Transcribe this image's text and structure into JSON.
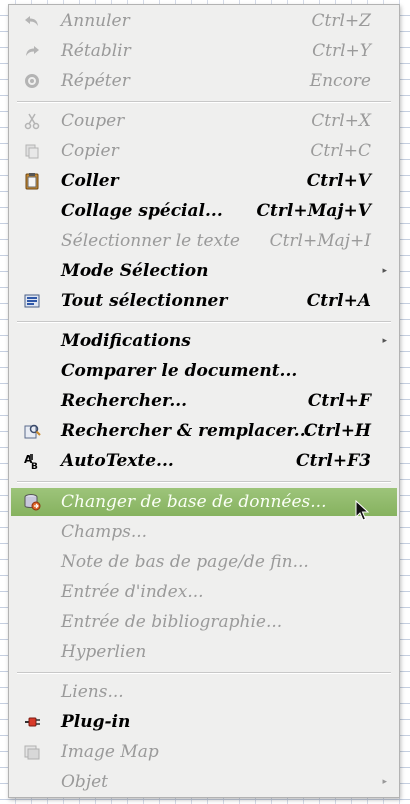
{
  "menu": {
    "items": [
      {
        "label": "Annuler",
        "shortcut": "Ctrl+Z",
        "icon": "undo-icon",
        "disabled": true
      },
      {
        "label": "Rétablir",
        "shortcut": "Ctrl+Y",
        "icon": "redo-icon",
        "disabled": true
      },
      {
        "label": "Répéter",
        "shortcut": "Encore",
        "icon": "repeat-icon",
        "disabled": true
      },
      {
        "label": "Couper",
        "shortcut": "Ctrl+X",
        "icon": "scissors-icon",
        "disabled": true
      },
      {
        "label": "Copier",
        "shortcut": "Ctrl+C",
        "icon": "copy-icon",
        "disabled": true
      },
      {
        "label": "Coller",
        "shortcut": "Ctrl+V",
        "icon": "paste-icon",
        "disabled": false
      },
      {
        "label": "Collage spécial...",
        "shortcut": "Ctrl+Maj+V",
        "icon": "",
        "disabled": false
      },
      {
        "label": "Sélectionner le texte",
        "shortcut": "Ctrl+Maj+I",
        "icon": "",
        "disabled": true
      },
      {
        "label": "Mode Sélection",
        "shortcut": "",
        "icon": "",
        "disabled": false,
        "submenu": true
      },
      {
        "label": "Tout sélectionner",
        "shortcut": "Ctrl+A",
        "icon": "select-all-icon",
        "disabled": false
      },
      {
        "label": "Modifications",
        "shortcut": "",
        "icon": "",
        "disabled": false,
        "submenu": true
      },
      {
        "label": "Comparer le document...",
        "shortcut": "",
        "icon": "",
        "disabled": false
      },
      {
        "label": "Rechercher...",
        "shortcut": "Ctrl+F",
        "icon": "",
        "disabled": false
      },
      {
        "label": "Rechercher & remplacer...",
        "shortcut": "Ctrl+H",
        "icon": "find-replace-icon",
        "disabled": false
      },
      {
        "label": "AutoTexte...",
        "shortcut": "Ctrl+F3",
        "icon": "autotext-icon",
        "disabled": false
      },
      {
        "label": "Changer de base de données...",
        "shortcut": "",
        "icon": "database-icon",
        "disabled": false,
        "selected": true
      },
      {
        "label": "Champs...",
        "shortcut": "",
        "icon": "",
        "disabled": true
      },
      {
        "label": "Note de bas de page/de fin...",
        "shortcut": "",
        "icon": "",
        "disabled": true
      },
      {
        "label": "Entrée d'index...",
        "shortcut": "",
        "icon": "",
        "disabled": true
      },
      {
        "label": "Entrée de bibliographie...",
        "shortcut": "",
        "icon": "",
        "disabled": true
      },
      {
        "label": "Hyperlien",
        "shortcut": "",
        "icon": "",
        "disabled": true
      },
      {
        "label": "Liens...",
        "shortcut": "",
        "icon": "",
        "disabled": true
      },
      {
        "label": "Plug-in",
        "shortcut": "",
        "icon": "plugin-icon",
        "disabled": false
      },
      {
        "label": "Image Map",
        "shortcut": "",
        "icon": "image-map-icon",
        "disabled": true
      },
      {
        "label": "Objet",
        "shortcut": "",
        "icon": "",
        "disabled": true,
        "submenu": true
      }
    ]
  },
  "colors": {
    "menu_bg": "#efefee",
    "highlight": "#8cb866",
    "disabled_text": "#9a9a9a"
  }
}
